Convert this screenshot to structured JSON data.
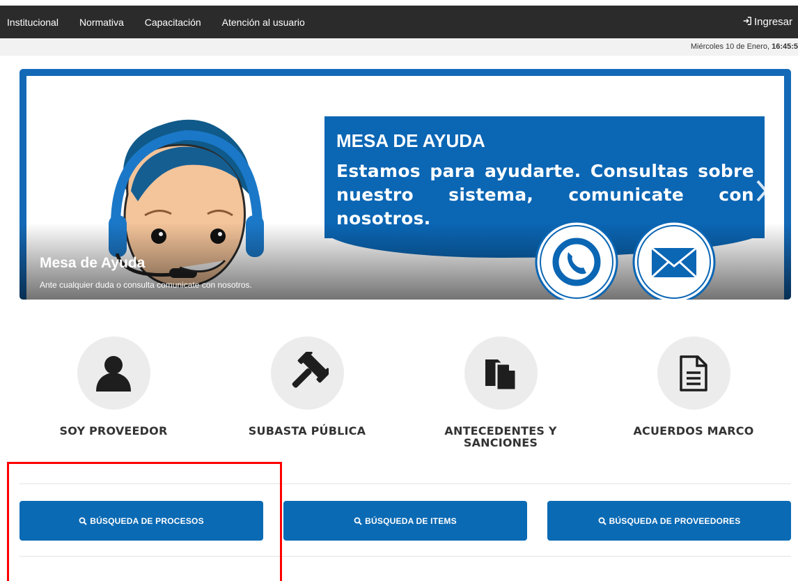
{
  "nav": {
    "items": [
      "Institucional",
      "Normativa",
      "Capacitación",
      "Atención al usuario"
    ],
    "login_label": "Ingresar",
    "login_icon": "sign-in-icon"
  },
  "datebar": {
    "date_prefix": "Miércoles 10 de Enero,",
    "time": "16:45:5"
  },
  "carousel": {
    "banner_title": "MESA DE AYUDA",
    "banner_text": "Estamos para ayudarte. Consultas sobre nuestro sistema, comunicate con nosotros.",
    "caption_title": "Mesa de Ayuda",
    "caption_text": "Ante cualquier duda o consulta comunicate con nosotros.",
    "prev_icon": "chevron-left-icon",
    "next_icon": "chevron-right-icon",
    "accent_color": "#0b66b4"
  },
  "features": [
    {
      "label_line1": "SOY PROVEEDOR",
      "label_line2": "",
      "icon": "user-icon"
    },
    {
      "label_line1": "SUBASTA PÚBLICA",
      "label_line2": "",
      "icon": "gavel-icon"
    },
    {
      "label_line1": "ANTECEDENTES Y",
      "label_line2": "SANCIONES",
      "icon": "documents-icon"
    },
    {
      "label_line1": "ACUERDOS MARCO",
      "label_line2": "",
      "icon": "document-icon"
    }
  ],
  "search_buttons": [
    {
      "label": "BÚSQUEDA DE PROCESOS"
    },
    {
      "label": "BÚSQUEDA DE ITEMS"
    },
    {
      "label": "BÚSQUEDA DE PROVEEDORES"
    }
  ],
  "colors": {
    "nav_bg": "#2b2b2b",
    "button_bg": "#0a6ab4",
    "highlight": "#ff0000"
  }
}
